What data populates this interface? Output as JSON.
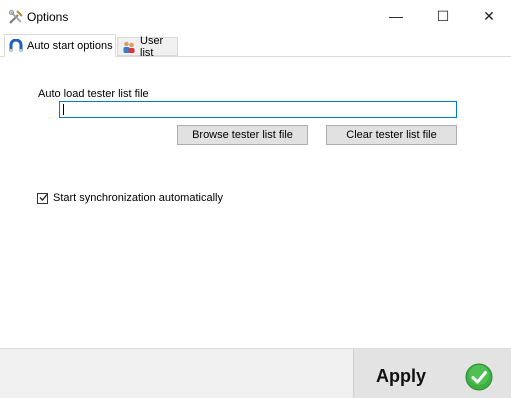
{
  "window": {
    "title": "Options",
    "icon": "tools-icon",
    "minimize_glyph": "—",
    "maximize_glyph": "☐",
    "close_glyph": "✕"
  },
  "tabs": [
    {
      "label": "Auto start options",
      "icon": "magnet-icon",
      "active": true
    },
    {
      "label": "User list",
      "icon": "users-icon",
      "active": false
    }
  ],
  "auto_start": {
    "file_label": "Auto load tester list file",
    "file_value": "",
    "browse_label": "Browse tester list file",
    "clear_label": "Clear tester list file",
    "sync_label": "Start synchronization automatically",
    "sync_checked": true
  },
  "footer": {
    "apply_label": "Apply",
    "apply_icon": "check-circle-icon"
  },
  "colors": {
    "accent": "#0078d7",
    "apply_green": "#3cb043"
  }
}
